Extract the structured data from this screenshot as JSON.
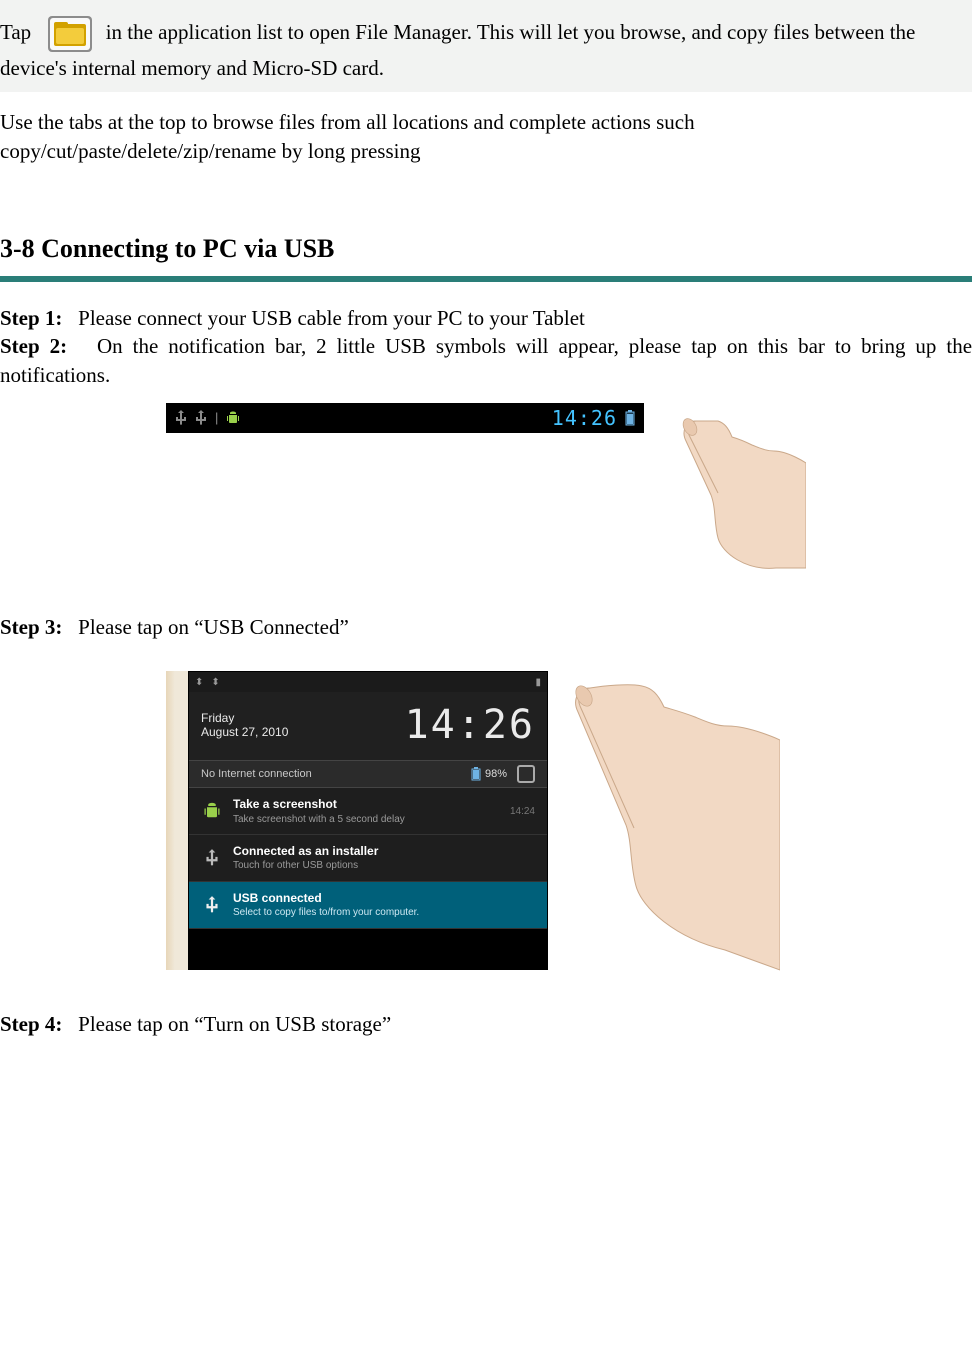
{
  "intro": {
    "p1a": "Tap",
    "p1b": "in the application list to open File Manager. This will let you browse, and copy files between the device's internal memory and Micro-SD card.",
    "p2": "Use the tabs at the top to browse files from all locations and complete actions such copy/cut/paste/delete/zip/rename by long pressing"
  },
  "heading": "3-8 Connecting to PC via USB",
  "steps": {
    "s1_label": "Step 1:",
    "s1_text": "Please connect your USB cable from your PC to your Tablet",
    "s2_label": "Step 2:",
    "s2_text": "On the notification bar, 2 little USB symbols will appear, please tap on this bar to bring up the notifications.",
    "s3_label": "Step 3:",
    "s3_text": "Please tap on “USB Connected”",
    "s4_label": "Step 4:",
    "s4_text": "Please tap on “Turn on USB storage”"
  },
  "fig1": {
    "clock": "14:26"
  },
  "fig2": {
    "day": "Friday",
    "date": "August 27, 2010",
    "bigtime": "14:26",
    "no_internet": "No Internet connection",
    "battery": "98%",
    "notif1_title": "Take a screenshot",
    "notif1_sub": "Take screenshot with a 5 second delay",
    "notif1_time": "14:24",
    "notif2_title": "Connected as an installer",
    "notif2_sub": "Touch for other USB options",
    "notif3_title": "USB connected",
    "notif3_sub": "Select to copy files to/from your computer."
  }
}
